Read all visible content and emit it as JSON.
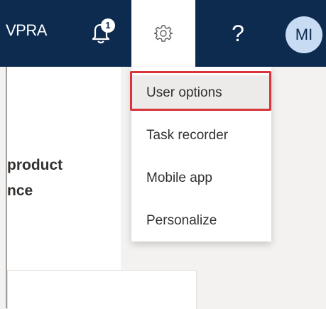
{
  "header": {
    "company": "VPRA",
    "notifications": {
      "icon": "bell-icon",
      "count": "1"
    },
    "settings": {
      "icon": "gear-icon"
    },
    "help_label": "?",
    "avatar_initials": "MI"
  },
  "content": {
    "heading_line1": "product",
    "heading_line2": "nce"
  },
  "settings_menu": {
    "items": [
      {
        "label": "User options"
      },
      {
        "label": "Task recorder"
      },
      {
        "label": "Mobile app"
      },
      {
        "label": "Personalize"
      }
    ]
  },
  "colors": {
    "header_bg": "#0d2a4f",
    "highlight": "#d9343a",
    "avatar_bg": "#c7dcf3"
  }
}
